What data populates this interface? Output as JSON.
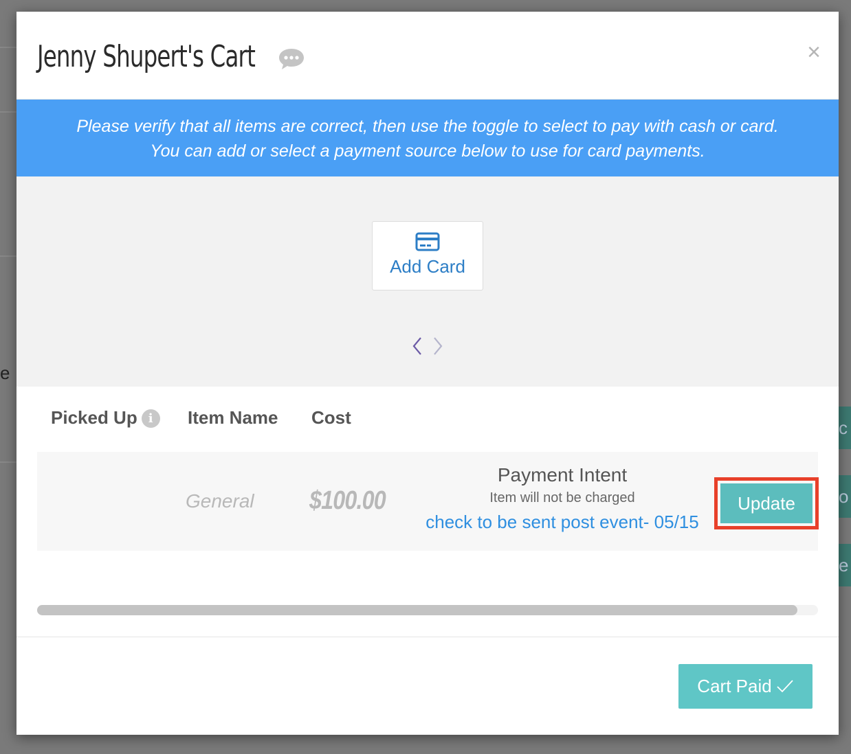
{
  "modal": {
    "title": "Jenny Shupert's Cart",
    "close_label": "×",
    "banner_line1": "Please verify that all items are correct, then use the toggle to select to pay with cash or card.",
    "banner_line2": "You can add or select a payment source below to use for card payments."
  },
  "payment": {
    "add_card_label": "Add Card"
  },
  "table": {
    "headers": [
      "Picked Up",
      "Item Name",
      "Cost"
    ],
    "info_glyph": "i",
    "rows": [
      {
        "item_name": "General",
        "cost": "$100.00",
        "intent_title": "Payment Intent",
        "intent_subtitle": "Item will not be charged",
        "intent_note": "check to be sent post event- 05/15",
        "action_label": "Update"
      }
    ]
  },
  "footer": {
    "cart_paid_label": "Cart Paid"
  },
  "background": {
    "partial_letters": [
      "e",
      "c",
      "o",
      "e"
    ]
  },
  "colors": {
    "banner": "#4a9ff5",
    "accent_teal": "#5cbdbd",
    "link_blue": "#2f8fe0",
    "highlight_red": "#e8402a"
  },
  "icons": [
    "chat-bubble-icon",
    "close-icon",
    "credit-card-icon",
    "chevron-left-icon",
    "chevron-right-icon",
    "info-icon",
    "checkmark-icon"
  ]
}
